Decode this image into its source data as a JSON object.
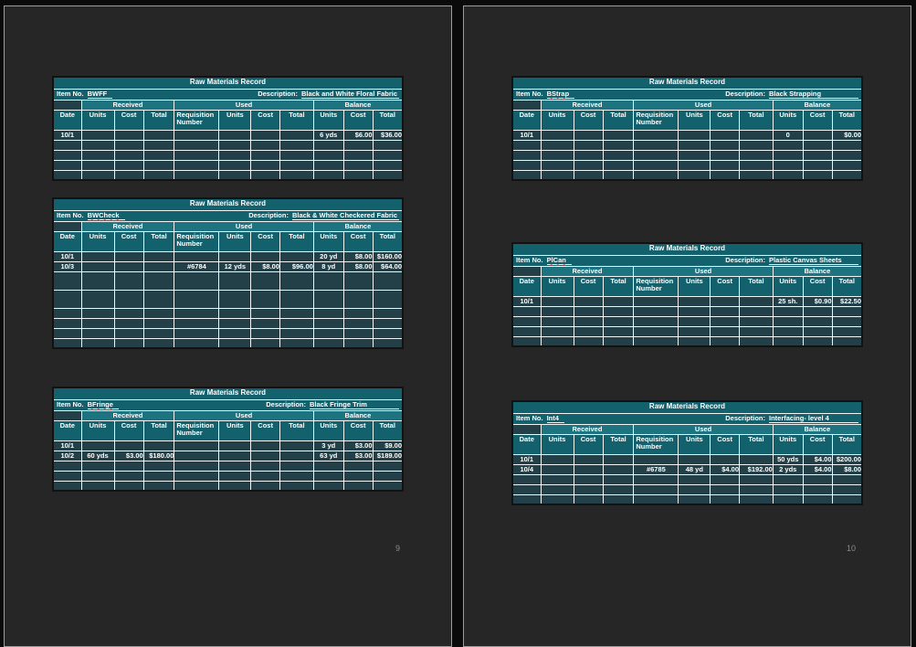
{
  "colors": {
    "canvas-bg": "#0a0a0a",
    "page-bg": "#262626",
    "page-border": "#9e9e9e",
    "header-teal": "#14616e",
    "group-teal": "#1e7380",
    "cell-teal": "#233f47",
    "grid-white": "#f2f5f5",
    "table-outline": "#101314",
    "text-white": "#ffffff",
    "squiggle-red": "#c0392b",
    "page-number": "#8c8c8c"
  },
  "pages": [
    {
      "number": "9",
      "tables": [
        {
          "title": "Raw Materials Record",
          "item_label": "Item No.",
          "item_no": "BWFF",
          "misspelled": false,
          "description_label": "Description:",
          "description": "Black and White Floral Fabric",
          "groups": [
            "Received",
            "Used",
            "Balance"
          ],
          "columns": [
            "Date",
            "Units",
            "Cost",
            "Total",
            "Requisition Number",
            "Units",
            "Cost",
            "Total",
            "Units",
            "Cost",
            "Total"
          ],
          "rows": [
            {
              "cells": [
                "10/1",
                "",
                "",
                "",
                "",
                "",
                "",
                "",
                "6 yds",
                "$6.00",
                "$36.00"
              ]
            },
            {
              "cells": [
                "",
                "",
                "",
                "",
                "",
                "",
                "",
                "",
                "",
                "",
                ""
              ]
            },
            {
              "cells": [
                "",
                "",
                "",
                "",
                "",
                "",
                "",
                "",
                "",
                "",
                ""
              ]
            },
            {
              "cells": [
                "",
                "",
                "",
                "",
                "",
                "",
                "",
                "",
                "",
                "",
                ""
              ]
            },
            {
              "cells": [
                "",
                "",
                "",
                "",
                "",
                "",
                "",
                "",
                "",
                "",
                ""
              ]
            }
          ]
        },
        {
          "title": "Raw Materials Record",
          "item_label": "Item No.",
          "item_no": "BWCheck",
          "misspelled": true,
          "description_label": "Description:",
          "description": "Black & White Checkered Fabric",
          "groups": [
            "Received",
            "Used",
            "Balance"
          ],
          "columns": [
            "Date",
            "Units",
            "Cost",
            "Total",
            "Requisition Number",
            "Units",
            "Cost",
            "Total",
            "Units",
            "Cost",
            "Total"
          ],
          "rows": [
            {
              "cells": [
                "10/1",
                "",
                "",
                "",
                "",
                "",
                "",
                "",
                "20 yd",
                "$8.00",
                "$160.00"
              ]
            },
            {
              "cells": [
                "10/3",
                "",
                "",
                "",
                "#6784",
                "12 yds",
                "$8.00",
                "$96.00",
                "8 yd",
                "$8.00",
                "$64.00"
              ]
            },
            {
              "tall": true,
              "cells": [
                "",
                "",
                "",
                "",
                "",
                "",
                "",
                "",
                "",
                "",
                ""
              ]
            },
            {
              "tall": true,
              "cells": [
                "",
                "",
                "",
                "",
                "",
                "",
                "",
                "",
                "",
                "",
                ""
              ]
            },
            {
              "cells": [
                "",
                "",
                "",
                "",
                "",
                "",
                "",
                "",
                "",
                "",
                ""
              ]
            },
            {
              "cells": [
                "",
                "",
                "",
                "",
                "",
                "",
                "",
                "",
                "",
                "",
                ""
              ]
            },
            {
              "cells": [
                "",
                "",
                "",
                "",
                "",
                "",
                "",
                "",
                "",
                "",
                ""
              ]
            },
            {
              "cells": [
                "",
                "",
                "",
                "",
                "",
                "",
                "",
                "",
                "",
                "",
                ""
              ]
            }
          ]
        },
        {
          "title": "Raw Materials Record",
          "item_label": "Item No.",
          "item_no": "BFringe",
          "misspelled": true,
          "description_label": "Description:",
          "description": "Black Fringe Trim",
          "groups": [
            "Received",
            "Used",
            "Balance"
          ],
          "columns": [
            "Date",
            "Units",
            "Cost",
            "Total",
            "Requisition Number",
            "Units",
            "Cost",
            "Total",
            "Units",
            "Cost",
            "Total"
          ],
          "rows": [
            {
              "cells": [
                "10/1",
                "",
                "",
                "",
                "",
                "",
                "",
                "",
                "3 yd",
                "$3.00",
                "$9.00"
              ]
            },
            {
              "cells": [
                "10/2",
                "60 yds",
                "$3.00",
                "$180.00",
                "",
                "",
                "",
                "",
                "63 yd",
                "$3.00",
                "$189.00"
              ]
            },
            {
              "cells": [
                "",
                "",
                "",
                "",
                "",
                "",
                "",
                "",
                "",
                "",
                ""
              ]
            },
            {
              "cells": [
                "",
                "",
                "",
                "",
                "",
                "",
                "",
                "",
                "",
                "",
                ""
              ]
            },
            {
              "cells": [
                "",
                "",
                "",
                "",
                "",
                "",
                "",
                "",
                "",
                "",
                ""
              ]
            }
          ]
        }
      ]
    },
    {
      "number": "10",
      "tables": [
        {
          "title": "Raw Materials Record",
          "item_label": "Item No.",
          "item_no": "BStrap",
          "misspelled": true,
          "description_label": "Description:",
          "description": "Black Strapping",
          "groups": [
            "Received",
            "Used",
            "Balance"
          ],
          "columns": [
            "Date",
            "Units",
            "Cost",
            "Total",
            "Requisition Number",
            "Units",
            "Cost",
            "Total",
            "Units",
            "Cost",
            "Total"
          ],
          "rows": [
            {
              "cells": [
                "10/1",
                "",
                "",
                "",
                "",
                "",
                "",
                "",
                "0",
                "",
                "$0.00"
              ]
            },
            {
              "cells": [
                "",
                "",
                "",
                "",
                "",
                "",
                "",
                "",
                "",
                "",
                ""
              ]
            },
            {
              "cells": [
                "",
                "",
                "",
                "",
                "",
                "",
                "",
                "",
                "",
                "",
                ""
              ]
            },
            {
              "cells": [
                "",
                "",
                "",
                "",
                "",
                "",
                "",
                "",
                "",
                "",
                ""
              ]
            },
            {
              "cells": [
                "",
                "",
                "",
                "",
                "",
                "",
                "",
                "",
                "",
                "",
                ""
              ]
            }
          ]
        },
        {
          "title": "Raw Materials Record",
          "item_label": "Item No.",
          "item_no": "PlCan",
          "misspelled": true,
          "description_label": "Description:",
          "description": "Plastic Canvas Sheets",
          "groups": [
            "Received",
            "Used",
            "Balance"
          ],
          "columns": [
            "Date",
            "Units",
            "Cost",
            "Total",
            "Requisition Number",
            "Units",
            "Cost",
            "Total",
            "Units",
            "Cost",
            "Total"
          ],
          "rows": [
            {
              "cells": [
                "10/1",
                "",
                "",
                "",
                "",
                "",
                "",
                "",
                "25 sh.",
                "$0.90",
                "$22.50"
              ]
            },
            {
              "cells": [
                "",
                "",
                "",
                "",
                "",
                "",
                "",
                "",
                "",
                "",
                ""
              ]
            },
            {
              "cells": [
                "",
                "",
                "",
                "",
                "",
                "",
                "",
                "",
                "",
                "",
                ""
              ]
            },
            {
              "cells": [
                "",
                "",
                "",
                "",
                "",
                "",
                "",
                "",
                "",
                "",
                ""
              ]
            },
            {
              "cells": [
                "",
                "",
                "",
                "",
                "",
                "",
                "",
                "",
                "",
                "",
                ""
              ]
            }
          ]
        },
        {
          "title": "Raw Materials Record",
          "item_label": "Item No.",
          "item_no": "Int4",
          "misspelled": false,
          "description_label": "Description:",
          "description": "Interfacing- level 4",
          "groups": [
            "Received",
            "Used",
            "Balance"
          ],
          "columns": [
            "Date",
            "Units",
            "Cost",
            "Total",
            "Requisition Number",
            "Units",
            "Cost",
            "Total",
            "Units",
            "Cost",
            "Total"
          ],
          "rows": [
            {
              "cells": [
                "10/1",
                "",
                "",
                "",
                "",
                "",
                "",
                "",
                "50 yds",
                "$4.00",
                "$200.00"
              ]
            },
            {
              "cells": [
                "10/4",
                "",
                "",
                "",
                "#6785",
                "48 yd",
                "$4.00",
                "$192.00",
                "2 yds",
                "$4.00",
                "$8.00"
              ]
            },
            {
              "cells": [
                "",
                "",
                "",
                "",
                "",
                "",
                "",
                "",
                "",
                "",
                ""
              ]
            },
            {
              "cells": [
                "",
                "",
                "",
                "",
                "",
                "",
                "",
                "",
                "",
                "",
                ""
              ]
            },
            {
              "cells": [
                "",
                "",
                "",
                "",
                "",
                "",
                "",
                "",
                "",
                "",
                ""
              ]
            }
          ]
        }
      ]
    }
  ]
}
